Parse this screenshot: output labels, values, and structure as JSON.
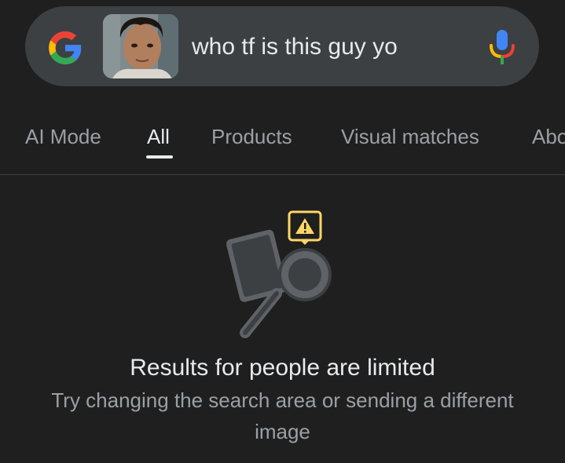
{
  "search": {
    "query": "who tf is this guy yo",
    "thumbnail": "uploaded-face-photo"
  },
  "tabs": [
    {
      "label": "AI Mode",
      "active": false
    },
    {
      "label": "All",
      "active": true
    },
    {
      "label": "Products",
      "active": false
    },
    {
      "label": "Visual matches",
      "active": false
    },
    {
      "label": "Abo",
      "active": false
    }
  ],
  "message": {
    "title": "Results for people are limited",
    "subtitle": "Try changing the search area or sending a different image"
  },
  "icons": {
    "logo": "google-g-icon",
    "mic": "microphone-icon",
    "illustration": "magnifier-warning-icon"
  },
  "colors": {
    "background": "#1f1f1f",
    "search_bar": "#3c4043",
    "warning": "#fdd663"
  }
}
